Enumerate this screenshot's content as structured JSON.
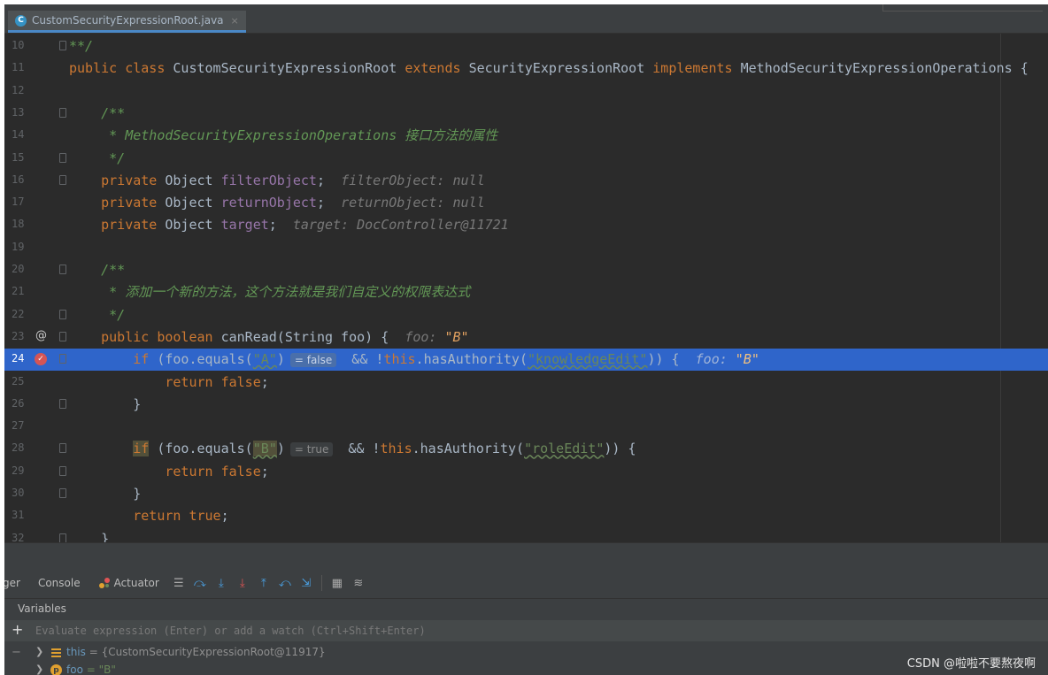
{
  "tab": {
    "icon_letter": "C",
    "label": "CustomSecurityExpressionRoot.java",
    "close": "×"
  },
  "lines": [
    {
      "n": "10",
      "segs": [
        [
          "d",
          "**/"
        ]
      ]
    },
    {
      "n": "11",
      "segs": [
        [
          "k",
          "public class "
        ],
        [
          "p",
          "CustomSecurityExpressionRoot "
        ],
        [
          "k",
          "extends "
        ],
        [
          "p",
          "SecurityExpressionRoot "
        ],
        [
          "k",
          "implements "
        ],
        [
          "p",
          "MethodSecurityExpressionOperations {"
        ]
      ]
    },
    {
      "n": "12",
      "segs": []
    },
    {
      "n": "13",
      "segs": [
        [
          "p",
          "    "
        ],
        [
          "d",
          "/**"
        ]
      ]
    },
    {
      "n": "14",
      "segs": [
        [
          "p",
          "    "
        ],
        [
          "d",
          " * MethodSecurityExpressionOperations 接口方法的属性"
        ]
      ]
    },
    {
      "n": "15",
      "segs": [
        [
          "p",
          "    "
        ],
        [
          "d",
          " */"
        ]
      ]
    },
    {
      "n": "16",
      "segs": [
        [
          "p",
          "    "
        ],
        [
          "k",
          "private "
        ],
        [
          "p",
          "Object "
        ],
        [
          "f",
          "filterObject"
        ],
        [
          "p",
          ";  "
        ],
        [
          "h",
          "filterObject: null"
        ]
      ]
    },
    {
      "n": "17",
      "segs": [
        [
          "p",
          "    "
        ],
        [
          "k",
          "private "
        ],
        [
          "p",
          "Object "
        ],
        [
          "f",
          "returnObject"
        ],
        [
          "p",
          ";  "
        ],
        [
          "h",
          "returnObject: null"
        ]
      ]
    },
    {
      "n": "18",
      "segs": [
        [
          "p",
          "    "
        ],
        [
          "k",
          "private "
        ],
        [
          "p",
          "Object "
        ],
        [
          "f",
          "target"
        ],
        [
          "p",
          ";  "
        ],
        [
          "h",
          "target: DocController@11721"
        ]
      ]
    },
    {
      "n": "19",
      "segs": []
    },
    {
      "n": "20",
      "segs": [
        [
          "p",
          "    "
        ],
        [
          "d",
          "/**"
        ]
      ]
    },
    {
      "n": "21",
      "segs": [
        [
          "p",
          "    "
        ],
        [
          "d",
          " * 添加一个新的方法，这个方法就是我们自定义的权限表达式"
        ]
      ]
    },
    {
      "n": "22",
      "segs": [
        [
          "p",
          "    "
        ],
        [
          "d",
          " */"
        ]
      ]
    },
    {
      "n": "23",
      "segs": [
        [
          "p",
          "    "
        ],
        [
          "k",
          "public boolean "
        ],
        [
          "p",
          "canRead(String foo) {  "
        ],
        [
          "h",
          "foo: "
        ],
        [
          "v",
          "\"B\""
        ]
      ]
    },
    {
      "n": "24",
      "segs": [
        [
          "p",
          "        "
        ],
        [
          "k",
          "if "
        ],
        [
          "p",
          "(foo.equals("
        ],
        [
          "s",
          "\"A\""
        ],
        [
          "p",
          ")"
        ],
        [
          "i",
          "= false"
        ],
        [
          "p",
          " && !"
        ],
        [
          "k",
          "this"
        ],
        [
          "p",
          ".hasAuthority("
        ],
        [
          "s",
          "\"knowledgeEdit\""
        ],
        [
          "p",
          ")) {  "
        ],
        [
          "h",
          "foo: "
        ],
        [
          "v",
          "\"B\""
        ]
      ]
    },
    {
      "n": "25",
      "segs": [
        [
          "p",
          "            "
        ],
        [
          "k",
          "return false"
        ],
        [
          "p",
          ";"
        ]
      ]
    },
    {
      "n": "26",
      "segs": [
        [
          "p",
          "        }"
        ]
      ]
    },
    {
      "n": "27",
      "segs": []
    },
    {
      "n": "28",
      "segs": [
        [
          "p",
          "        "
        ],
        [
          "kh",
          "if"
        ],
        [
          "p",
          " (foo.equals("
        ],
        [
          "sh",
          "\"B\""
        ],
        [
          "p",
          ")"
        ],
        [
          "i",
          "= true"
        ],
        [
          "p",
          " && !"
        ],
        [
          "k",
          "this"
        ],
        [
          "p",
          ".hasAuthority("
        ],
        [
          "s",
          "\"roleEdit\""
        ],
        [
          "p",
          ")) {"
        ]
      ]
    },
    {
      "n": "29",
      "segs": [
        [
          "p",
          "            "
        ],
        [
          "k",
          "return false"
        ],
        [
          "p",
          ";"
        ]
      ]
    },
    {
      "n": "30",
      "segs": [
        [
          "p",
          "        }"
        ]
      ]
    },
    {
      "n": "31",
      "segs": [
        [
          "p",
          "        "
        ],
        [
          "k",
          "return true"
        ],
        [
          "p",
          ";"
        ]
      ]
    },
    {
      "n": "32",
      "segs": [
        [
          "p",
          "    }"
        ]
      ]
    }
  ],
  "debug": {
    "tab_debugger": "ger",
    "tab_console": "Console",
    "tab_actuator": "Actuator",
    "variables_label": "Variables",
    "eval_plus": "+",
    "eval_placeholder": "Evaluate expression (Enter) or add a watch (Ctrl+Shift+Enter)",
    "vars": [
      {
        "name": "this",
        "value": " = {CustomSecurityExpressionRoot@11917}"
      },
      {
        "name": "foo",
        "value": " = \"B\""
      }
    ]
  },
  "watermark": "CSDN @啦啦不要熬夜啊"
}
